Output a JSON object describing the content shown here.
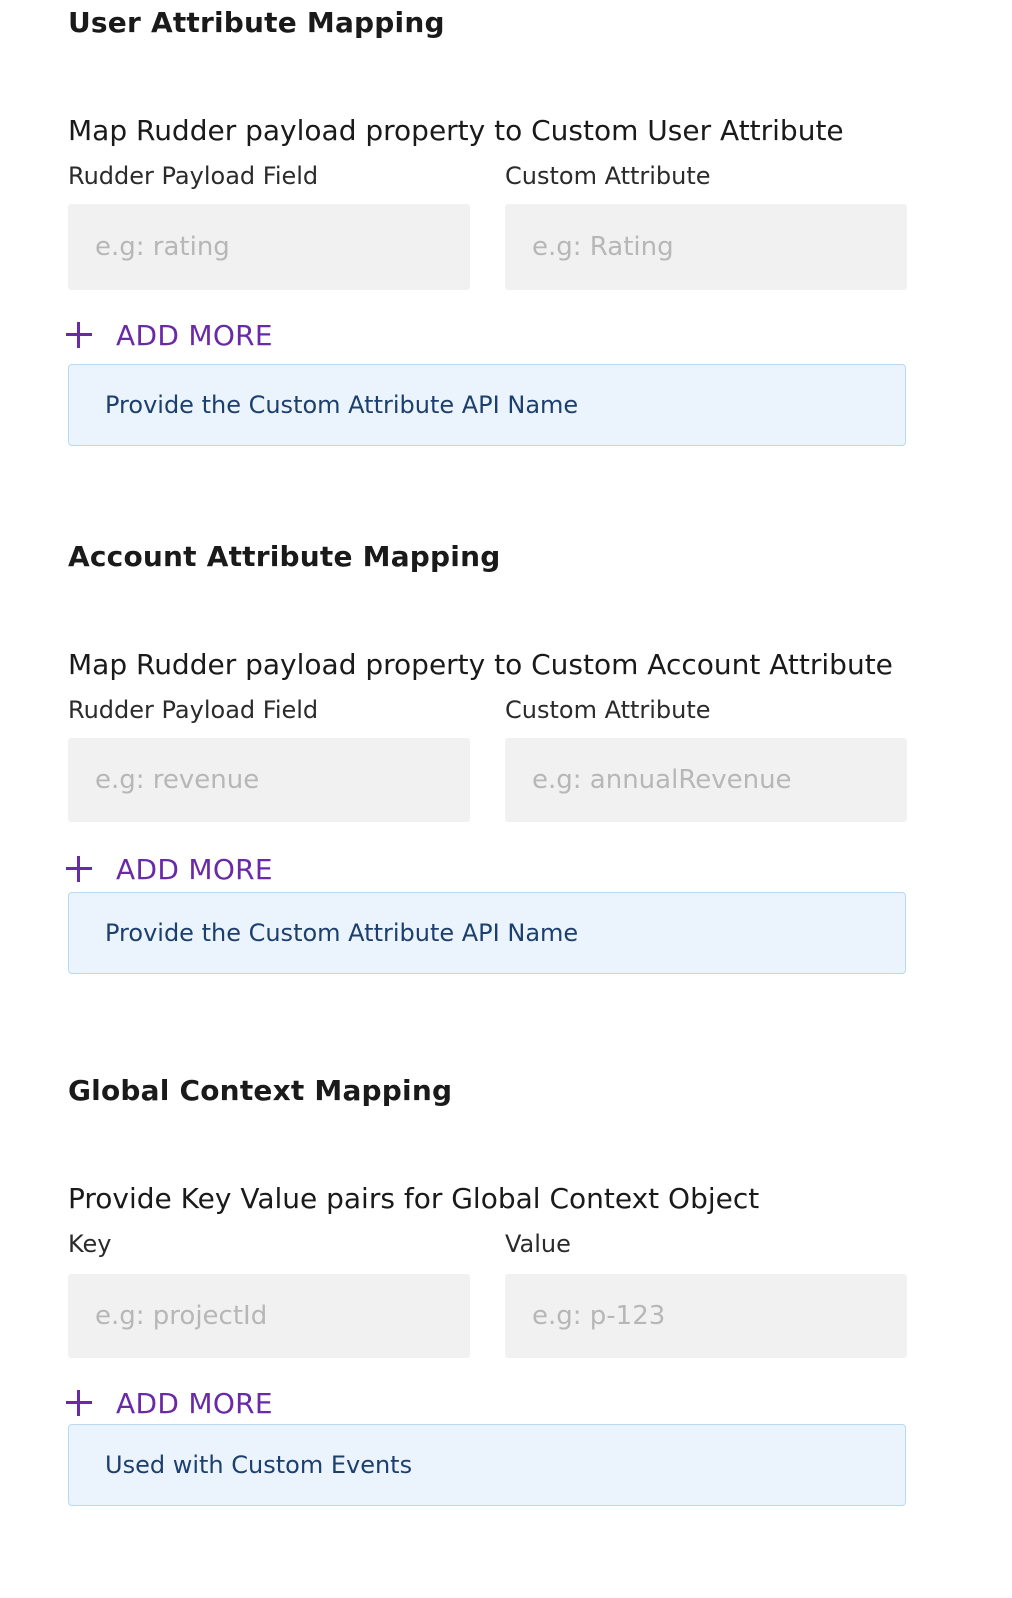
{
  "sections": [
    {
      "title": "User Attribute Mapping",
      "mapping_title": "Map Rudder payload property to Custom User Attribute",
      "left_label": "Rudder Payload Field",
      "right_label": "Custom Attribute",
      "left_placeholder": "e.g: rating",
      "right_placeholder": "e.g: Rating",
      "add_more": "ADD MORE",
      "info": "Provide the Custom Attribute API Name"
    },
    {
      "title": "Account Attribute Mapping",
      "mapping_title": "Map Rudder payload property to Custom Account Attribute",
      "left_label": "Rudder Payload Field",
      "right_label": "Custom Attribute",
      "left_placeholder": "e.g: revenue",
      "right_placeholder": "e.g: annualRevenue",
      "add_more": "ADD MORE",
      "info": "Provide the Custom Attribute API Name"
    },
    {
      "title": "Global Context Mapping",
      "mapping_title": "Provide Key Value pairs for Global Context Object",
      "left_label": "Key",
      "right_label": "Value",
      "left_placeholder": "e.g: projectId",
      "right_placeholder": "e.g: p-123",
      "add_more": "ADD MORE",
      "info": "Used with Custom Events"
    }
  ],
  "colors": {
    "accent": "#6a2aa8",
    "input_bg": "#f1f1f1",
    "info_bg": "#ebf4fd",
    "info_border": "#b9d8f2",
    "info_text": "#1d3f6e"
  }
}
